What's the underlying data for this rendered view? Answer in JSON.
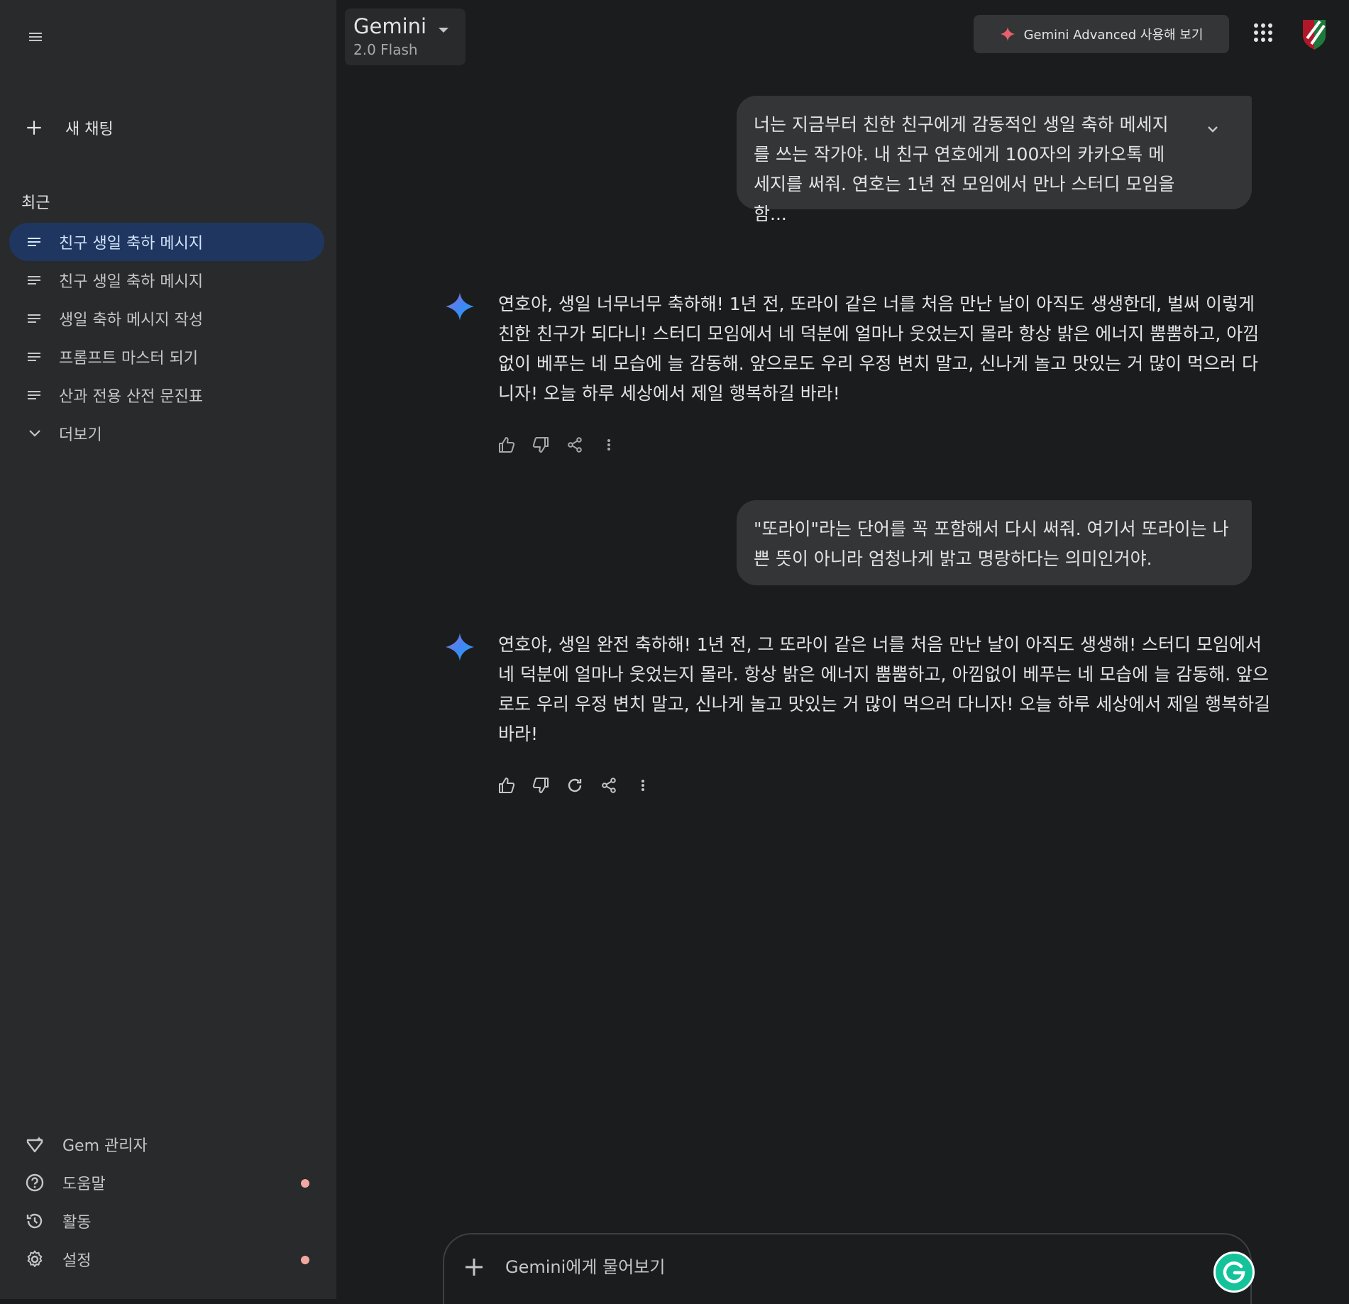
{
  "sidebar": {
    "menu_icon": "hamburger-icon",
    "new_chat_label": "새 채팅",
    "recent_title": "최근",
    "recent_items": [
      {
        "label": "친구 생일 축하 메시지",
        "active": true
      },
      {
        "label": "친구 생일 축하 메시지",
        "active": false
      },
      {
        "label": "생일 축하 메시지 작성",
        "active": false
      },
      {
        "label": "프롬프트 마스터 되기",
        "active": false
      },
      {
        "label": "산과 전용 산전 문진표",
        "active": false
      }
    ],
    "more_label": "더보기",
    "bottom_items": [
      {
        "label": "Gem 관리자",
        "icon": "gem-icon"
      },
      {
        "label": "도움말",
        "icon": "help-icon",
        "has_dot": true
      },
      {
        "label": "활동",
        "icon": "history-icon"
      },
      {
        "label": "설정",
        "icon": "settings-icon",
        "has_dot": true
      }
    ]
  },
  "header": {
    "model_name": "Gemini",
    "model_version": "2.0 Flash",
    "advanced_label": "Gemini Advanced 사용해 보기"
  },
  "chat": {
    "messages": [
      {
        "role": "user",
        "text": "너는 지금부터 친한 친구에게 감동적인 생일 축하 메세지를 쓰는 작가야. 내 친구 연호에게 100자의 카카오톡 메세지를 써줘. 연호는 1년 전 모임에서 만나 스터디 모임을 함..."
      },
      {
        "role": "model",
        "text": "연호야, 생일 너무너무 축하해! 1년 전, 또라이 같은 너를 처음 만난 날이 아직도 생생한데, 벌써 이렇게 친한 친구가 되다니! 스터디 모임에서 네 덕분에 얼마나 웃었는지 몰라 항상 밝은 에너지 뿜뿜하고, 아낌없이 베푸는 네 모습에 늘 감동해. 앞으로도 우리 우정 변치 말고, 신나게 놀고 맛있는 거 많이 먹으러 다니자! 오늘 하루 세상에서 제일 행복하길 바라!"
      },
      {
        "role": "user",
        "text": "\"또라이\"라는 단어를 꼭 포함해서 다시 써줘. 여기서 또라이는 나쁜 뜻이 아니라 엄청나게 밝고 명랑하다는 의미인거야."
      },
      {
        "role": "model",
        "text": "연호야, 생일 완전 축하해! 1년 전, 그 또라이 같은 너를 처음 만난 날이 아직도 생생해! 스터디 모임에서 네 덕분에 얼마나 웃었는지 몰라. 항상 밝은 에너지 뿜뿜하고, 아낌없이 베푸는 네 모습에 늘 감동해. 앞으로도 우리 우정 변치 말고, 신나게 놀고 맛있는 거 많이 먹으러 다니자! 오늘 하루 세상에서 제일 행복하길 바라!"
      }
    ]
  },
  "input": {
    "placeholder": "Gemini에게 물어보기"
  },
  "colors": {
    "background": "#1b1c1d",
    "sidebar": "#282a2c",
    "active_item": "#1f3760",
    "bubble": "#333537",
    "spark_blue": "#4285f4",
    "advanced_star": "#e8606b"
  }
}
